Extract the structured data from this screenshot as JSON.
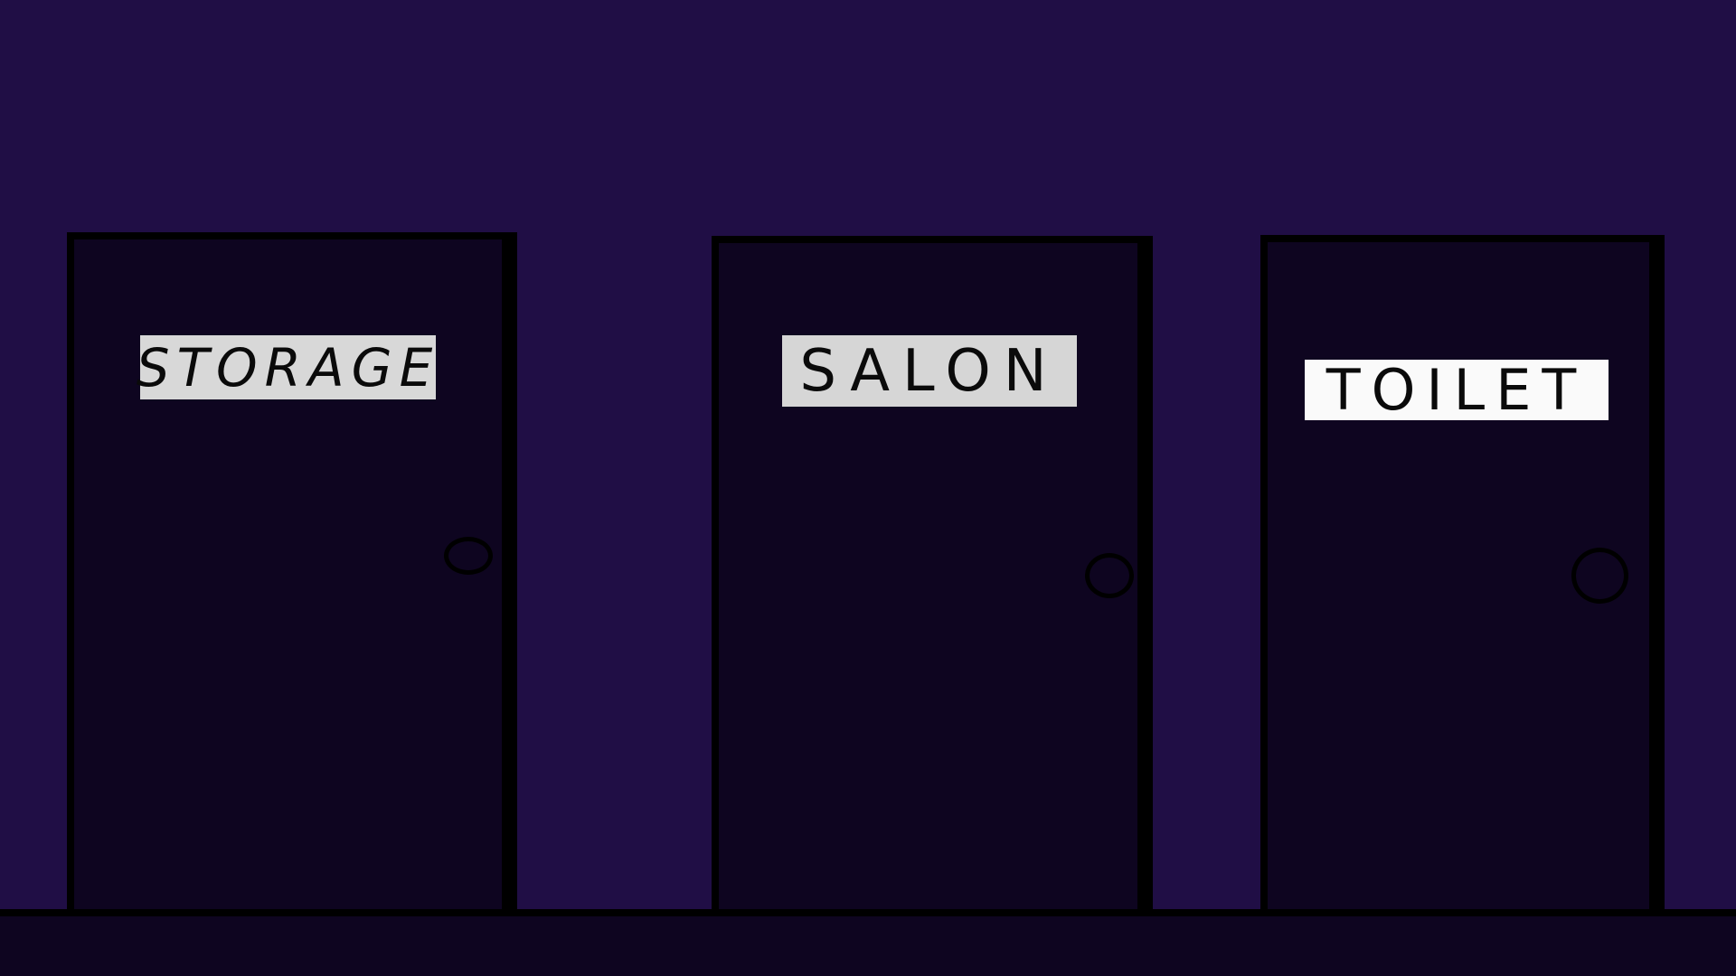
{
  "scene": {
    "background_color": "#200e45",
    "door_color": "#0e0520",
    "outline_color": "#000000"
  },
  "doors": [
    {
      "id": "storage",
      "label": "STORAGE",
      "sign_color": "#d8d8d8"
    },
    {
      "id": "salon",
      "label": "SALON",
      "sign_color": "#d6d6d6"
    },
    {
      "id": "toilet",
      "label": "TOILET",
      "sign_color": "#fafafa"
    }
  ]
}
